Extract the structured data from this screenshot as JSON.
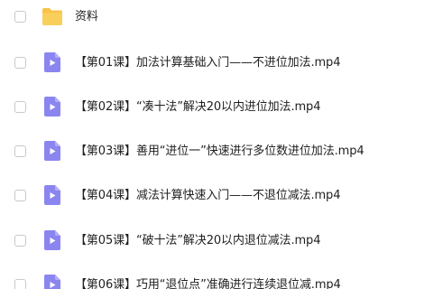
{
  "files": [
    {
      "type": "folder",
      "icon": "folder-icon",
      "name": "资料"
    },
    {
      "type": "video",
      "icon": "video-file-icon",
      "name": "【第01课】加法计算基础入门——不进位加法.mp4"
    },
    {
      "type": "video",
      "icon": "video-file-icon",
      "name": "【第02课】“凑十法”解决20以内进位加法.mp4"
    },
    {
      "type": "video",
      "icon": "video-file-icon",
      "name": "【第03课】善用“进位一”快速进行多位数进位加法.mp4"
    },
    {
      "type": "video",
      "icon": "video-file-icon",
      "name": "【第04课】减法计算快速入门——不退位减法.mp4"
    },
    {
      "type": "video",
      "icon": "video-file-icon",
      "name": "【第05课】“破十法”解决20以内退位减法.mp4"
    },
    {
      "type": "video",
      "icon": "video-file-icon",
      "name": "【第06课】巧用“退位点”准确进行连续退位减.mp4"
    }
  ],
  "colors": {
    "folder": "#f7c448",
    "video_icon": "#8b85f0",
    "video_icon_fold": "#b3aef7",
    "checkbox_border": "#c8c9cc",
    "text": "#1f1f1f"
  }
}
